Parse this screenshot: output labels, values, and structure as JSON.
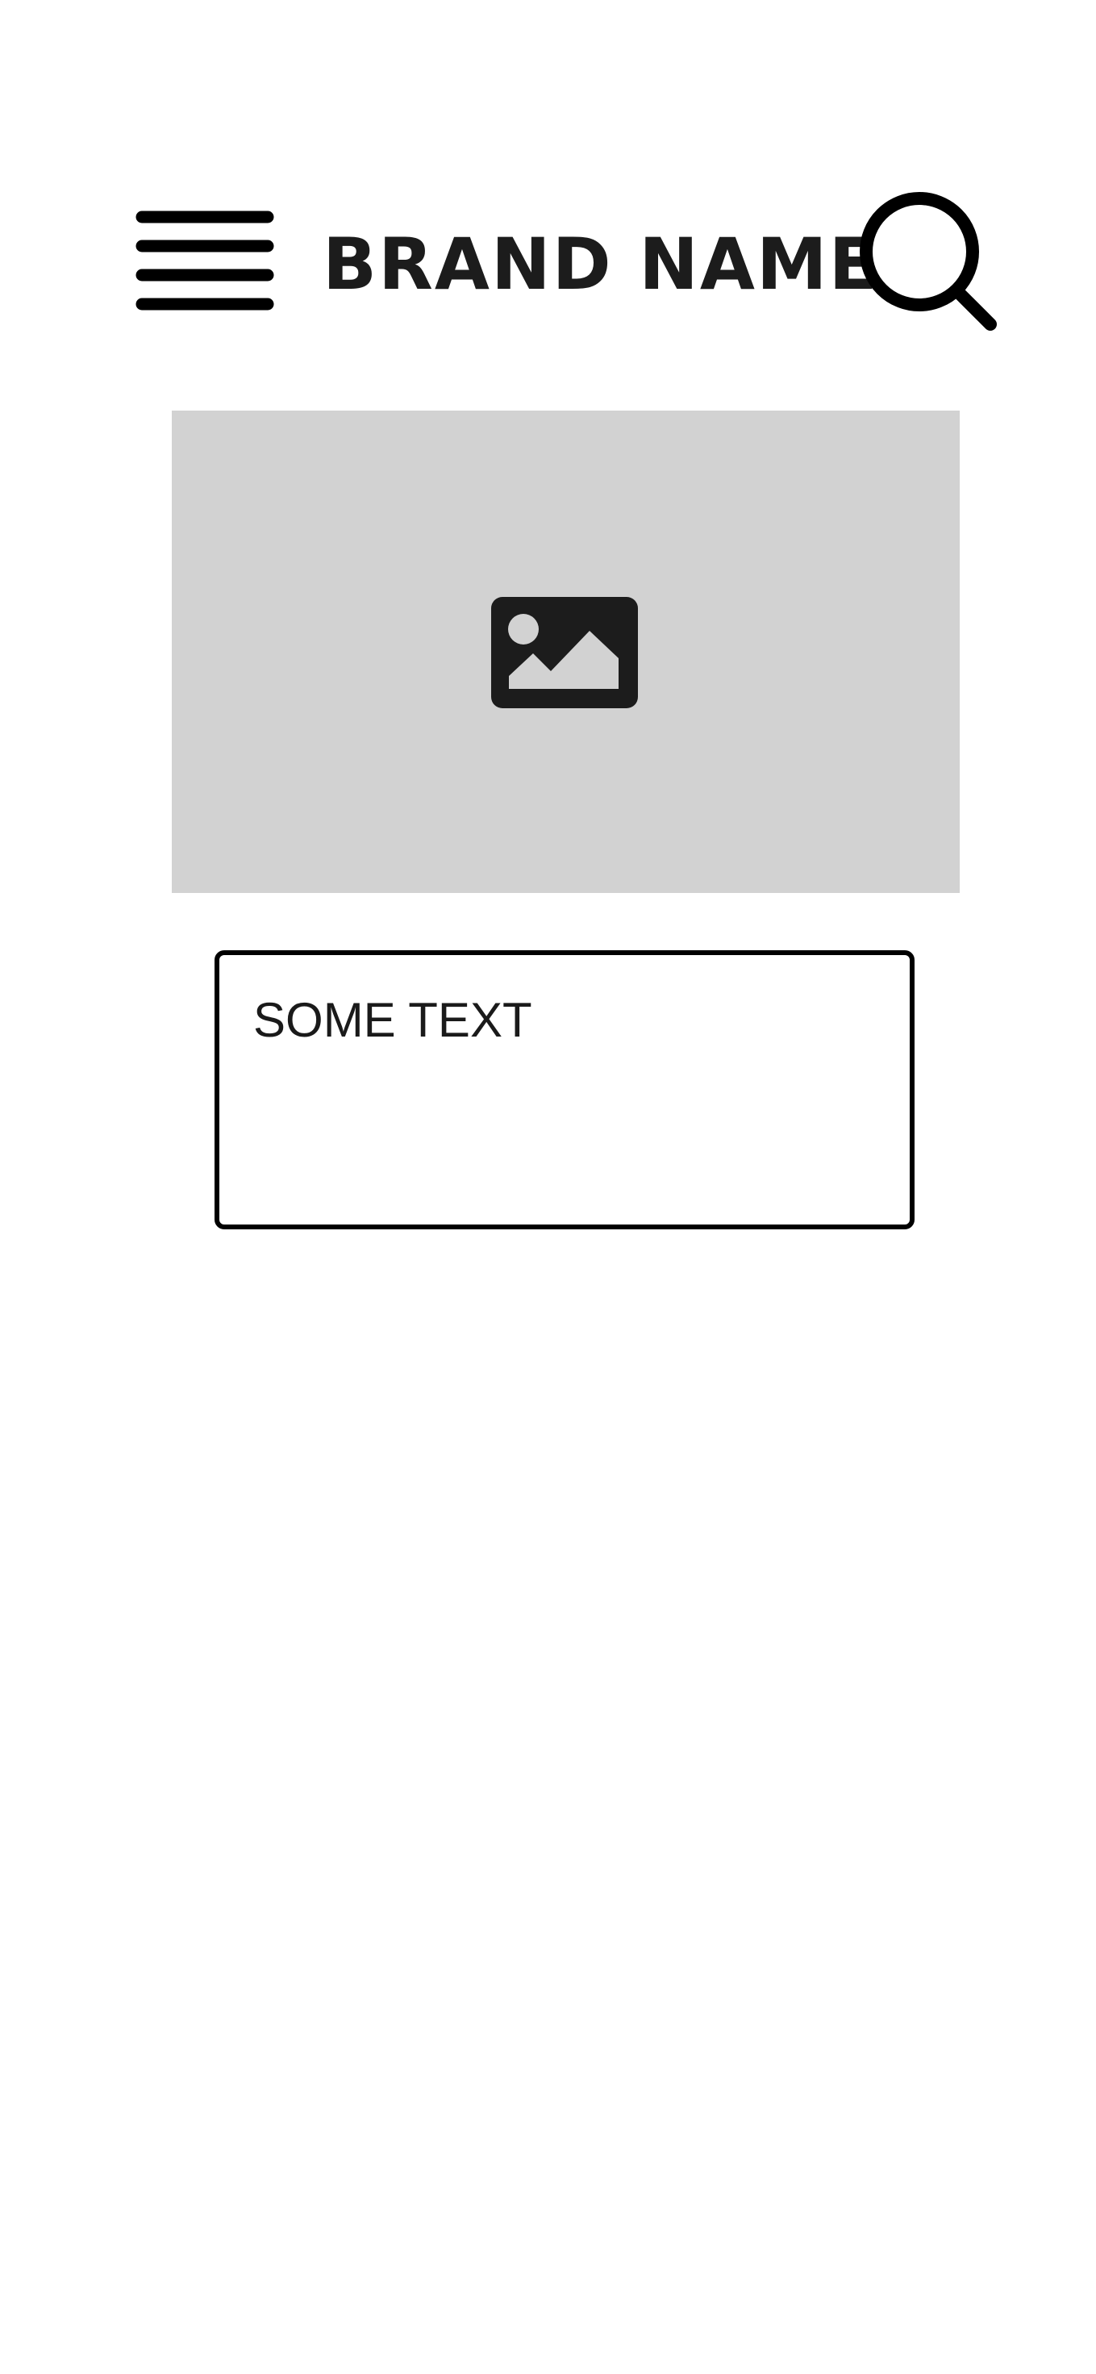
{
  "header": {
    "brand_name": "BRAND NAME",
    "menu_icon": "hamburger-menu-icon",
    "search_icon": "search-icon"
  },
  "hero": {
    "placeholder_icon": "image-placeholder-icon",
    "background_color": "#d2d2d2"
  },
  "card": {
    "text": "SOME TEXT",
    "border_color": "#000000"
  }
}
